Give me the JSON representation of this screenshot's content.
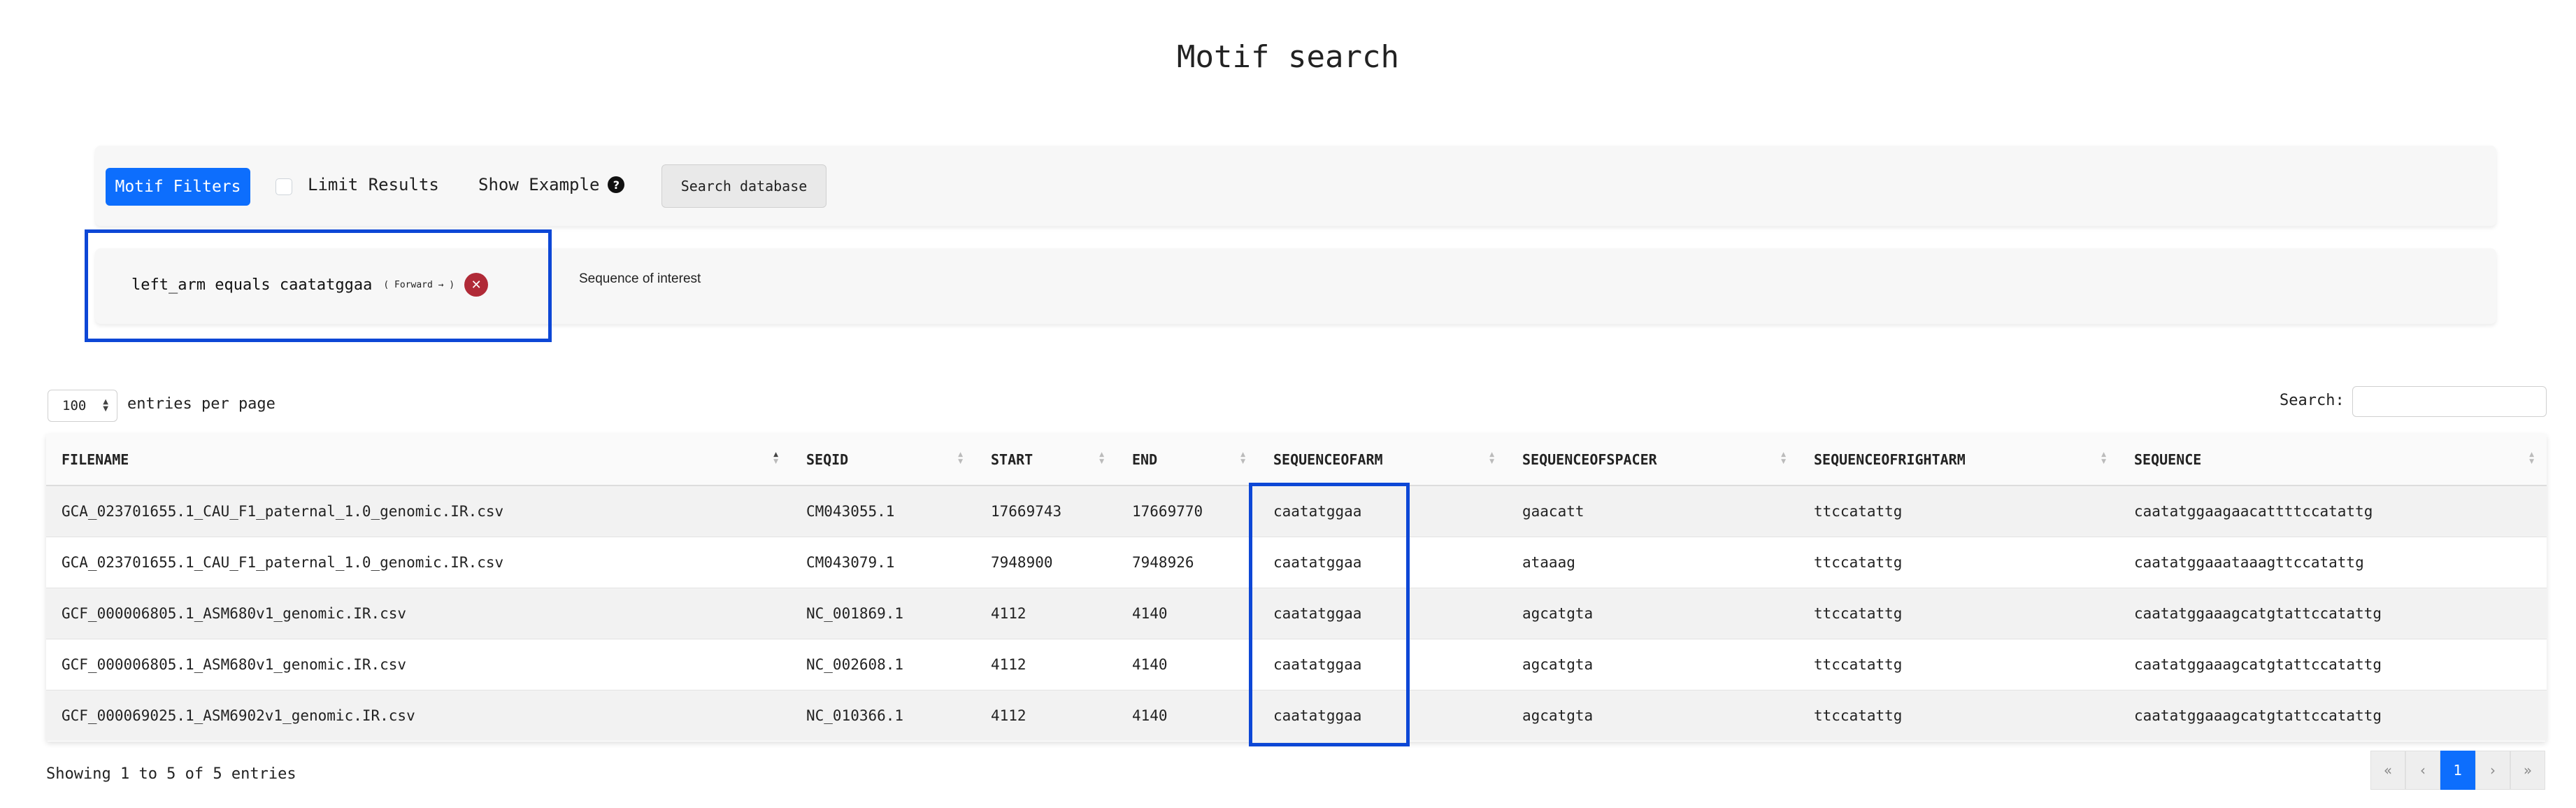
{
  "page_title": "Motif search",
  "toolbar": {
    "motif_filters_label": "Motif Filters",
    "limit_results_label": "Limit Results",
    "limit_results_checked": false,
    "show_example_label": "Show Example",
    "search_database_label": "Search database"
  },
  "filter": {
    "text": "left_arm equals caatatggaa",
    "direction": "( Forward → )",
    "remove_icon": "close-icon",
    "description": "Sequence of interest"
  },
  "entries": {
    "per_page_value": "100",
    "label": "entries per page"
  },
  "search": {
    "label": "Search:",
    "value": ""
  },
  "table": {
    "columns": [
      "FILENAME",
      "SEQID",
      "START",
      "END",
      "SEQUENCEOFARM",
      "SEQUENCEOFSPACER",
      "SEQUENCEOFRIGHTARM",
      "SEQUENCE"
    ],
    "rows": [
      [
        "GCA_023701655.1_CAU_F1_paternal_1.0_genomic.IR.csv",
        "CM043055.1",
        "17669743",
        "17669770",
        "caatatggaa",
        "gaacatt",
        "ttccatattg",
        "caatatggaagaacattttccatattg"
      ],
      [
        "GCA_023701655.1_CAU_F1_paternal_1.0_genomic.IR.csv",
        "CM043079.1",
        "7948900",
        "7948926",
        "caatatggaa",
        "ataaag",
        "ttccatattg",
        "caatatggaaataaagttccatattg"
      ],
      [
        "GCF_000006805.1_ASM680v1_genomic.IR.csv",
        "NC_001869.1",
        "4112",
        "4140",
        "caatatggaa",
        "agcatgta",
        "ttccatattg",
        "caatatggaaagcatgtattccatattg"
      ],
      [
        "GCF_000006805.1_ASM680v1_genomic.IR.csv",
        "NC_002608.1",
        "4112",
        "4140",
        "caatatggaa",
        "agcatgta",
        "ttccatattg",
        "caatatggaaagcatgtattccatattg"
      ],
      [
        "GCF_000069025.1_ASM6902v1_genomic.IR.csv",
        "NC_010366.1",
        "4112",
        "4140",
        "caatatggaa",
        "agcatgta",
        "ttccatattg",
        "caatatggaaagcatgtattccatattg"
      ]
    ]
  },
  "info_text": "Showing 1 to 5 of 5 entries",
  "pagination": {
    "first": "«",
    "prev": "‹",
    "current": "1",
    "next": "›",
    "last": "»"
  },
  "colors": {
    "primary": "#0d6efd",
    "danger": "#b02a37",
    "highlight_border": "#0d47d6"
  }
}
